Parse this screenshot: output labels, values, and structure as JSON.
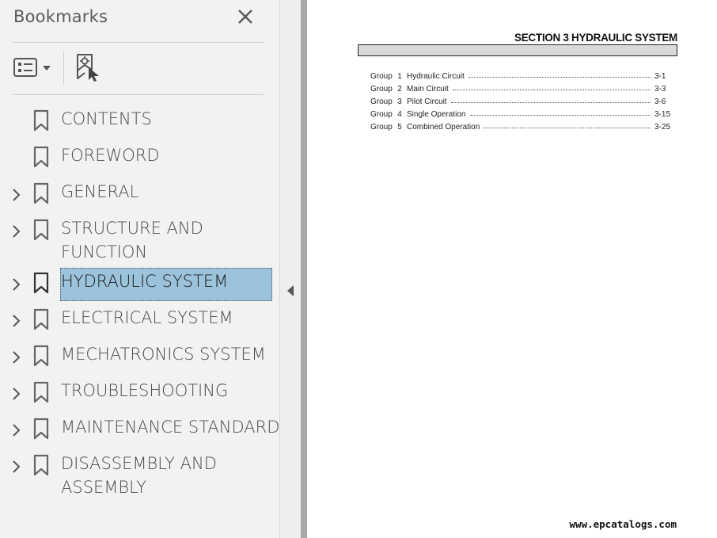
{
  "panel": {
    "title": "Bookmarks",
    "close_icon": "close-icon",
    "options_icon": "bookmark-options-icon",
    "new_bookmark_icon": "new-bookmark-icon",
    "items": [
      {
        "label": "CONTENTS",
        "expandable": false,
        "selected": false
      },
      {
        "label": "FOREWORD",
        "expandable": false,
        "selected": false
      },
      {
        "label": "GENERAL",
        "expandable": true,
        "selected": false
      },
      {
        "label_lines": [
          "STRUCTURE AND",
          "FUNCTION"
        ],
        "expandable": true,
        "selected": false
      },
      {
        "label": "HYDRAULIC SYSTEM",
        "expandable": true,
        "selected": true
      },
      {
        "label": "ELECTRICAL SYSTEM",
        "expandable": true,
        "selected": false
      },
      {
        "label": "MECHATRONICS SYSTEM",
        "expandable": true,
        "selected": false
      },
      {
        "label": "TROUBLESHOOTING",
        "expandable": true,
        "selected": false
      },
      {
        "label": "MAINTENANCE STANDARD",
        "expandable": true,
        "selected": false
      },
      {
        "label_lines": [
          "DISASSEMBLY AND",
          "ASSEMBLY"
        ],
        "expandable": true,
        "selected": false
      }
    ],
    "selected_color": "#9cc3dc"
  },
  "document": {
    "section_title": "SECTION 3 HYDRAULIC SYSTEM",
    "toc": [
      {
        "group": "Group",
        "num": "1",
        "title": "Hydraulic Circuit",
        "page": "3-1"
      },
      {
        "group": "Group",
        "num": "2",
        "title": "Main Circuit",
        "page": "3-3"
      },
      {
        "group": "Group",
        "num": "3",
        "title": "Pilot Circuit",
        "page": "3-6"
      },
      {
        "group": "Group",
        "num": "4",
        "title": "Single Operation",
        "page": "3-15"
      },
      {
        "group": "Group",
        "num": "5",
        "title": "Combined Operation",
        "page": "3-25"
      }
    ],
    "watermark": "www.epcatalogs.com"
  }
}
